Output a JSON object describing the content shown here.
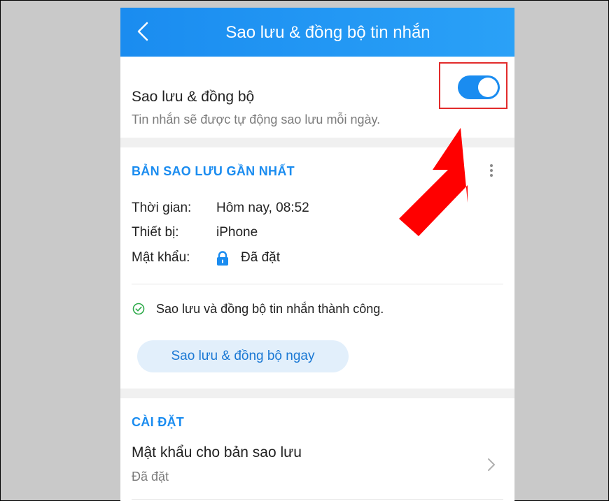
{
  "header": {
    "title": "Sao lưu & đồng bộ tin nhắn",
    "back_icon": "chevron-left-icon"
  },
  "sync": {
    "title": "Sao lưu & đồng bộ",
    "subtitle": "Tin nhắn sẽ được tự động sao lưu mỗi ngày.",
    "enabled": true
  },
  "backup": {
    "heading": "BẢN SAO LƯU GẦN NHẤT",
    "time_label": "Thời gian:",
    "time_value": "Hôm nay, 08:52",
    "device_label": "Thiết bị:",
    "device_value": "iPhone",
    "password_label": "Mật khẩu:",
    "password_value": "Đã đặt",
    "status": "Sao lưu và đồng bộ tin nhắn thành công.",
    "sync_now": "Sao lưu & đồng bộ ngay"
  },
  "settings": {
    "heading": "CÀI ĐẶT",
    "password_title": "Mật khẩu cho bản sao lưu",
    "password_sub": "Đã đặt"
  },
  "colors": {
    "accent": "#1a8cf0",
    "highlight": "#e22b2b",
    "arrow": "#ff0000"
  }
}
